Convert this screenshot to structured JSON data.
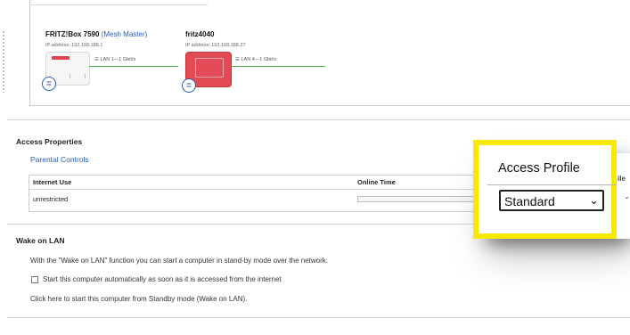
{
  "mesh": {
    "devices": [
      {
        "name": "FRITZ!Box 7590",
        "role": "(Mesh Master)",
        "ip": "IP address: 192.168.188.1"
      },
      {
        "name": "fritz4040",
        "ip": "IP address: 192.168.188.27"
      }
    ],
    "links": [
      "LAN 1—1 Gbit/s",
      "LAN 4—1 Gbit/s"
    ]
  },
  "access": {
    "title": "Access Properties",
    "parental_link": "Parental Controls",
    "table": {
      "headers": [
        "Internet Use",
        "Online Time"
      ],
      "rows": [
        [
          "unrestricted",
          ""
        ]
      ]
    }
  },
  "callout": {
    "label": "Access Profile",
    "select_value": "Standard",
    "clipped_header": "ile"
  },
  "wol": {
    "title": "Wake on LAN",
    "description": "With the \"Wake on LAN\" function you can start a computer in stand-by mode over the network.",
    "checkbox_label": "Start this computer automatically as soon as it is accessed from the internet",
    "action_text": "Click here to start this computer from Standby mode (Wake on LAN)."
  },
  "colors": {
    "highlight": "#f6ea00",
    "link": "#2a5da8",
    "line": "#4caf50",
    "device_red": "#e0454f"
  }
}
